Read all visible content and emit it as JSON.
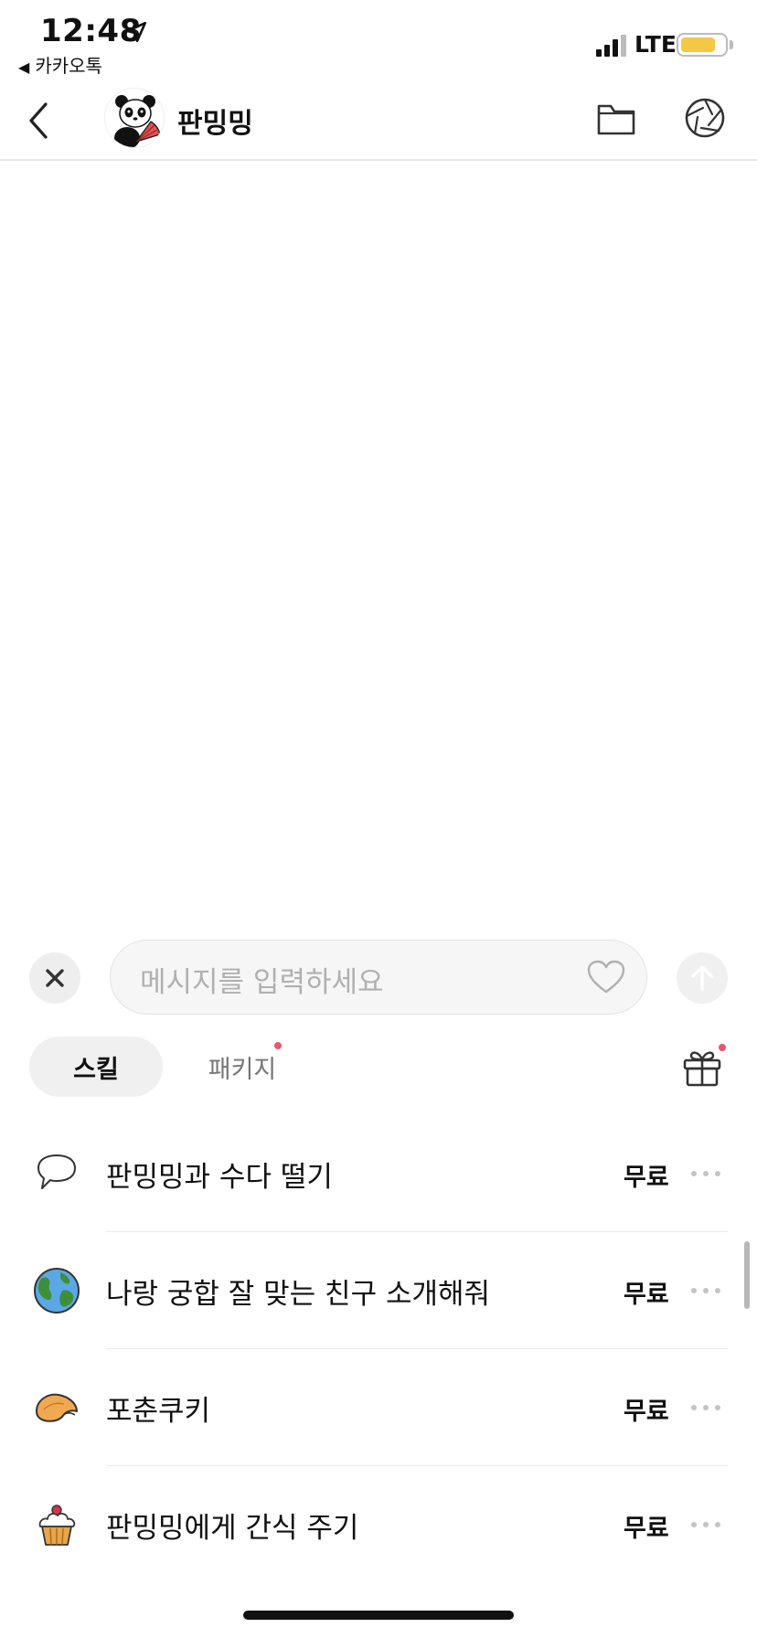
{
  "status_bar": {
    "time": "12:48",
    "back_app": "카카오톡",
    "network": "LTE",
    "battery_level": 0.8
  },
  "header": {
    "title": "판밍밍",
    "back_icon": "chevron-left-icon",
    "folder_icon": "folder-icon",
    "aperture_icon": "camera-aperture-icon"
  },
  "composer": {
    "placeholder": "메시지를 입력하세요"
  },
  "tabs": {
    "skill": "스킬",
    "package": "패키지"
  },
  "skills": [
    {
      "icon": "speech-bubble-icon",
      "label": "판밍밍과 수다 떨기",
      "price": "무료"
    },
    {
      "icon": "globe-icon",
      "label": "나랑 궁합 잘 맞는 친구 소개해줘",
      "price": "무료"
    },
    {
      "icon": "fortune-cookie-icon",
      "label": "포춘쿠키",
      "price": "무료"
    },
    {
      "icon": "cupcake-icon",
      "label": "판밍밍에게 간식 주기",
      "price": "무료"
    }
  ],
  "colors": {
    "notification_dot": "#e8566c",
    "battery": "#f5c843"
  }
}
